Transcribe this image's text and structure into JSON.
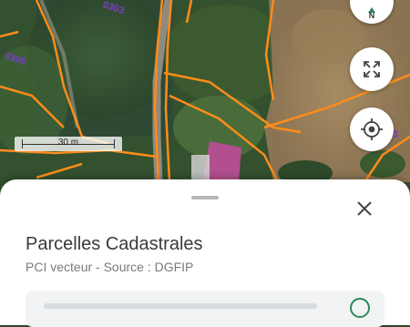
{
  "map": {
    "parcel_labels": [
      "0303",
      "0396"
    ],
    "partial_label": "3",
    "road_color": "#ff8c1a",
    "building_color": "#b24f8e",
    "label_color": "#7a3fc4"
  },
  "scale_bar": {
    "label": "30 m"
  },
  "controls": {
    "north_icon": "compass-north-icon",
    "north_letter": "N",
    "expand_icon": "expand-icon",
    "locate_icon": "crosshair-locate-icon"
  },
  "bottom_sheet": {
    "title": "Parcelles Cadastrales",
    "subtitle": "PCI vecteur - Source : DGFIP",
    "close_icon": "close-icon"
  }
}
